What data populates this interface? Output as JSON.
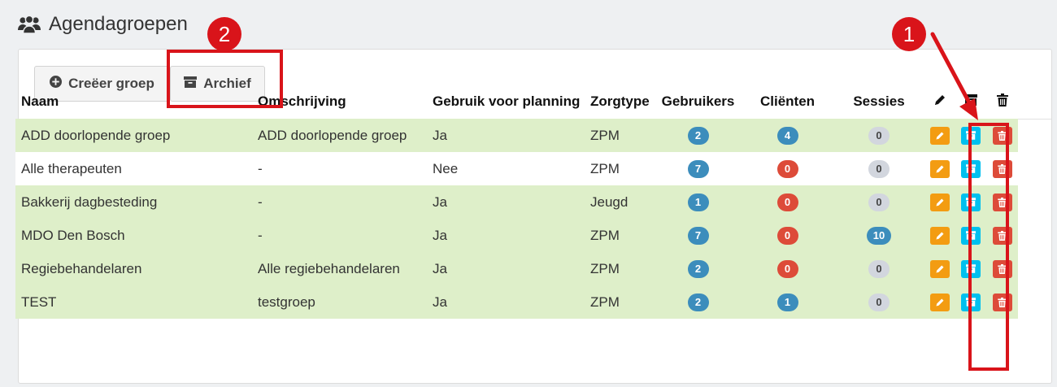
{
  "header": {
    "title": "Agendagroepen",
    "icon": "users-icon"
  },
  "toolbar": {
    "create_label": "Creëer groep",
    "archive_label": "Archief"
  },
  "table": {
    "columns": [
      "Naam",
      "Omschrijving",
      "Gebruik voor planning",
      "Zorgtype",
      "Gebruikers",
      "Cliënten",
      "Sessies"
    ],
    "action_icons": [
      "pencil-icon",
      "archive-icon",
      "trash-icon"
    ],
    "rows": [
      {
        "naam": "ADD doorlopende groep",
        "omschrijving": "ADD doorlopende groep",
        "planning": "Ja",
        "zorgtype": "ZPM",
        "gebruikers": "2",
        "clienten": "4",
        "sessies": "0"
      },
      {
        "naam": "Alle therapeuten",
        "omschrijving": "-",
        "planning": "Nee",
        "zorgtype": "ZPM",
        "gebruikers": "7",
        "clienten": "0",
        "sessies": "0"
      },
      {
        "naam": "Bakkerij dagbesteding",
        "omschrijving": "-",
        "planning": "Ja",
        "zorgtype": "Jeugd",
        "gebruikers": "1",
        "clienten": "0",
        "sessies": "0"
      },
      {
        "naam": "MDO Den Bosch",
        "omschrijving": "-",
        "planning": "Ja",
        "zorgtype": "ZPM",
        "gebruikers": "7",
        "clienten": "0",
        "sessies": "10"
      },
      {
        "naam": "Regiebehandelaren",
        "omschrijving": "Alle regiebehandelaren",
        "planning": "Ja",
        "zorgtype": "ZPM",
        "gebruikers": "2",
        "clienten": "0",
        "sessies": "0"
      },
      {
        "naam": "TEST",
        "omschrijving": "testgroep",
        "planning": "Ja",
        "zorgtype": "ZPM",
        "gebruikers": "2",
        "clienten": "1",
        "sessies": "0"
      }
    ]
  },
  "annotations": {
    "marker_1": "1",
    "marker_2": "2"
  },
  "colors": {
    "row_green": "#deefc9",
    "badge_blue": "#3c8dbc",
    "badge_red": "#dd4b39",
    "badge_gray": "#d2d6de",
    "edit_orange": "#f39c12",
    "archive_cyan": "#00c0ef",
    "delete_red": "#dd4b39",
    "annotation_red": "#d9141a"
  }
}
